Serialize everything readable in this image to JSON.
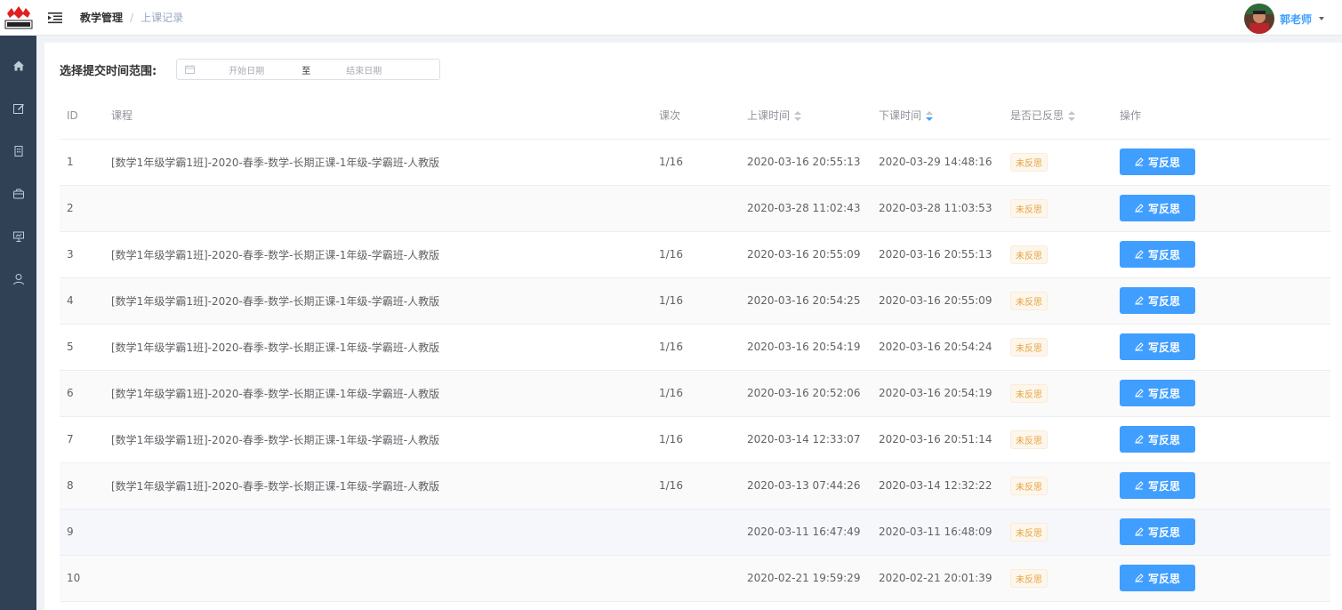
{
  "header": {
    "breadcrumb_root": "教学管理",
    "breadcrumb_separator": "/",
    "breadcrumb_current": "上课记录",
    "username": "郭老师"
  },
  "sidebar": {
    "items": [
      {
        "icon": "home-icon"
      },
      {
        "icon": "edit-icon"
      },
      {
        "icon": "building-icon"
      },
      {
        "icon": "box-icon"
      },
      {
        "icon": "presentation-icon"
      },
      {
        "icon": "user-icon"
      }
    ]
  },
  "filter": {
    "label": "选择提交时间范围:",
    "start_placeholder": "开始日期",
    "separator": "至",
    "end_placeholder": "结束日期"
  },
  "table": {
    "columns": {
      "id": "ID",
      "course": "课程",
      "count": "课次",
      "start": "上课时间",
      "end": "下课时间",
      "reflected": "是否已反思",
      "op": "操作"
    },
    "rows": [
      {
        "id": "1",
        "course": "[数学1年级学霸1班]-2020-春季-数学-长期正课-1年级-学霸班-人教版",
        "count": "1/16",
        "start": "2020-03-16 20:55:13",
        "end": "2020-03-29 14:48:16",
        "reflected": "未反思",
        "action": "写反思"
      },
      {
        "id": "2",
        "course": "",
        "count": "",
        "start": "2020-03-28 11:02:43",
        "end": "2020-03-28 11:03:53",
        "reflected": "未反思",
        "action": "写反思"
      },
      {
        "id": "3",
        "course": "[数学1年级学霸1班]-2020-春季-数学-长期正课-1年级-学霸班-人教版",
        "count": "1/16",
        "start": "2020-03-16 20:55:09",
        "end": "2020-03-16 20:55:13",
        "reflected": "未反思",
        "action": "写反思"
      },
      {
        "id": "4",
        "course": "[数学1年级学霸1班]-2020-春季-数学-长期正课-1年级-学霸班-人教版",
        "count": "1/16",
        "start": "2020-03-16 20:54:25",
        "end": "2020-03-16 20:55:09",
        "reflected": "未反思",
        "action": "写反思"
      },
      {
        "id": "5",
        "course": "[数学1年级学霸1班]-2020-春季-数学-长期正课-1年级-学霸班-人教版",
        "count": "1/16",
        "start": "2020-03-16 20:54:19",
        "end": "2020-03-16 20:54:24",
        "reflected": "未反思",
        "action": "写反思"
      },
      {
        "id": "6",
        "course": "[数学1年级学霸1班]-2020-春季-数学-长期正课-1年级-学霸班-人教版",
        "count": "1/16",
        "start": "2020-03-16 20:52:06",
        "end": "2020-03-16 20:54:19",
        "reflected": "未反思",
        "action": "写反思"
      },
      {
        "id": "7",
        "course": "[数学1年级学霸1班]-2020-春季-数学-长期正课-1年级-学霸班-人教版",
        "count": "1/16",
        "start": "2020-03-14 12:33:07",
        "end": "2020-03-16 20:51:14",
        "reflected": "未反思",
        "action": "写反思"
      },
      {
        "id": "8",
        "course": "[数学1年级学霸1班]-2020-春季-数学-长期正课-1年级-学霸班-人教版",
        "count": "1/16",
        "start": "2020-03-13 07:44:26",
        "end": "2020-03-14 12:32:22",
        "reflected": "未反思",
        "action": "写反思"
      },
      {
        "id": "9",
        "course": "",
        "count": "",
        "start": "2020-03-11 16:47:49",
        "end": "2020-03-11 16:48:09",
        "reflected": "未反思",
        "action": "写反思"
      },
      {
        "id": "10",
        "course": "",
        "count": "",
        "start": "2020-02-21 19:59:29",
        "end": "2020-02-21 20:01:39",
        "reflected": "未反思",
        "action": "写反思"
      }
    ]
  },
  "colors": {
    "sidebar_bg": "#304156",
    "primary": "#409eff",
    "warning": "#e6a23c"
  }
}
